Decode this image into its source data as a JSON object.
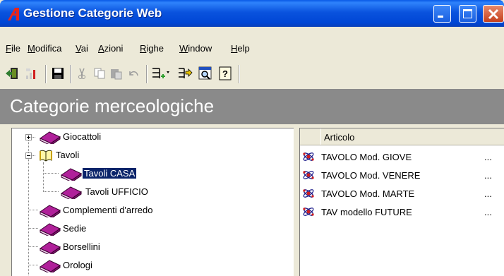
{
  "window": {
    "title": "Gestione Categorie Web"
  },
  "menu": [
    "File",
    "Modifica",
    "Vai",
    "Azioni",
    "Righe",
    "Window",
    "Help"
  ],
  "header": {
    "title": "Categorie merceologiche"
  },
  "tree": {
    "items": [
      {
        "label": "Giocattoli"
      },
      {
        "label": "Tavoli"
      },
      {
        "label": "Tavoli CASA",
        "selected": true
      },
      {
        "label": "Tavoli UFFICIO"
      },
      {
        "label": "Complementi d'arredo"
      },
      {
        "label": "Sedie"
      },
      {
        "label": "Borsellini"
      },
      {
        "label": "Orologi"
      }
    ]
  },
  "list": {
    "column_header": "Articolo",
    "rows": [
      {
        "name": "TAVOLO Mod. GIOVE",
        "extra": "..."
      },
      {
        "name": "TAVOLO Mod. VENERE",
        "extra": "..."
      },
      {
        "name": "TAVOLO Mod. MARTE",
        "extra": "..."
      },
      {
        "name": "TAV modello FUTURE",
        "extra": "..."
      }
    ]
  },
  "colors": {
    "titlebar": "#0054e3",
    "header_band": "#8a8a8a",
    "selection": "#0a246a",
    "book_icon": "#b0209a"
  }
}
